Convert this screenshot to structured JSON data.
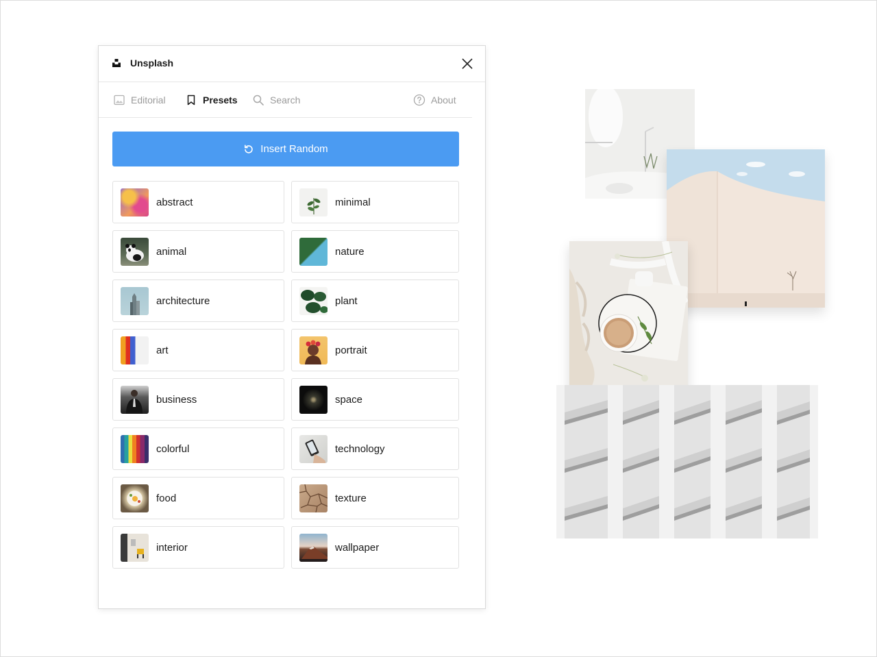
{
  "app": {
    "title": "Unsplash",
    "close_icon": "close-icon",
    "logo_icon": "unsplash-logo-icon"
  },
  "tabs": [
    {
      "label": "Editorial",
      "icon": "image-icon",
      "active": false
    },
    {
      "label": "Presets",
      "icon": "bookmark-icon",
      "active": true
    },
    {
      "label": "Search",
      "icon": "search-icon",
      "active": false
    },
    {
      "label": "About",
      "icon": "help-circle-icon",
      "active": false
    }
  ],
  "insert_random": {
    "label": "Insert Random",
    "icon": "refresh-icon",
    "color": "#4b9bf2"
  },
  "presets_left": [
    "abstract",
    "animal",
    "architecture",
    "art",
    "business",
    "colorful",
    "food",
    "interior"
  ],
  "presets_right": [
    "minimal",
    "nature",
    "plant",
    "portrait",
    "space",
    "technology",
    "texture",
    "wallpaper"
  ],
  "colors": {
    "accent": "#4b9bf2",
    "text": "#1a1a1a",
    "muted": "#9a9a9a",
    "border": "#e1e1e1"
  }
}
